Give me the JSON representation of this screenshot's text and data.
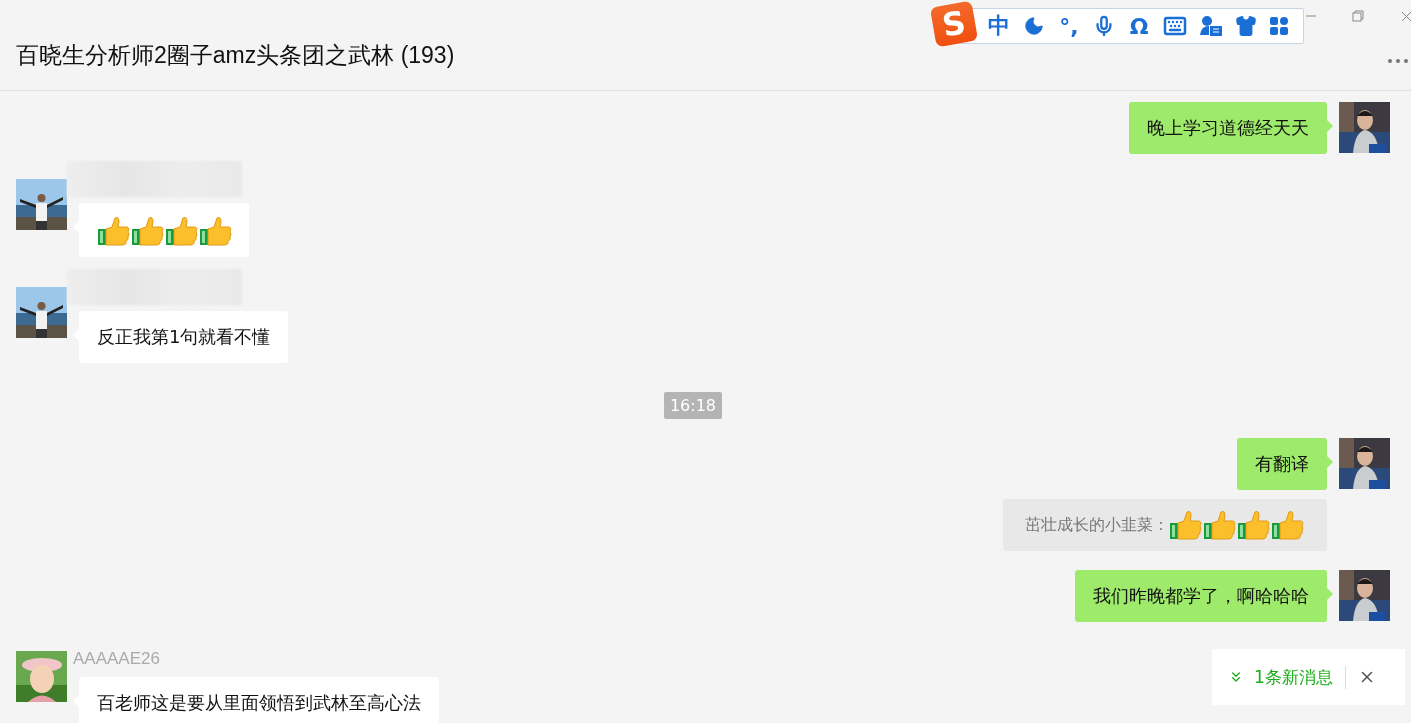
{
  "window": {
    "title": "百晓生分析师2圈子amz头条团之武林 (193)"
  },
  "ime_toolbar": {
    "logo": "S",
    "mode": "中",
    "punctuation": "°,",
    "symbol": "Ω"
  },
  "messages": [
    {
      "kind": "outgoing",
      "text": "晚上学习道德经天天"
    },
    {
      "kind": "incoming_thumbs",
      "name_hidden": true
    },
    {
      "kind": "incoming",
      "name_hidden": true,
      "text": "反正我第1句就看不懂"
    },
    {
      "kind": "time",
      "text": "16:18"
    },
    {
      "kind": "outgoing",
      "text": "有翻译"
    },
    {
      "kind": "quote",
      "text": "茁壮成长的小韭菜："
    },
    {
      "kind": "outgoing",
      "text": "我们昨晚都学了，啊哈哈哈"
    },
    {
      "kind": "incoming",
      "name": "AAAAAE26",
      "text": "百老师这是要从里面领悟到武林至高心法"
    }
  ],
  "new_message_bar": {
    "text": "1条新消息"
  }
}
